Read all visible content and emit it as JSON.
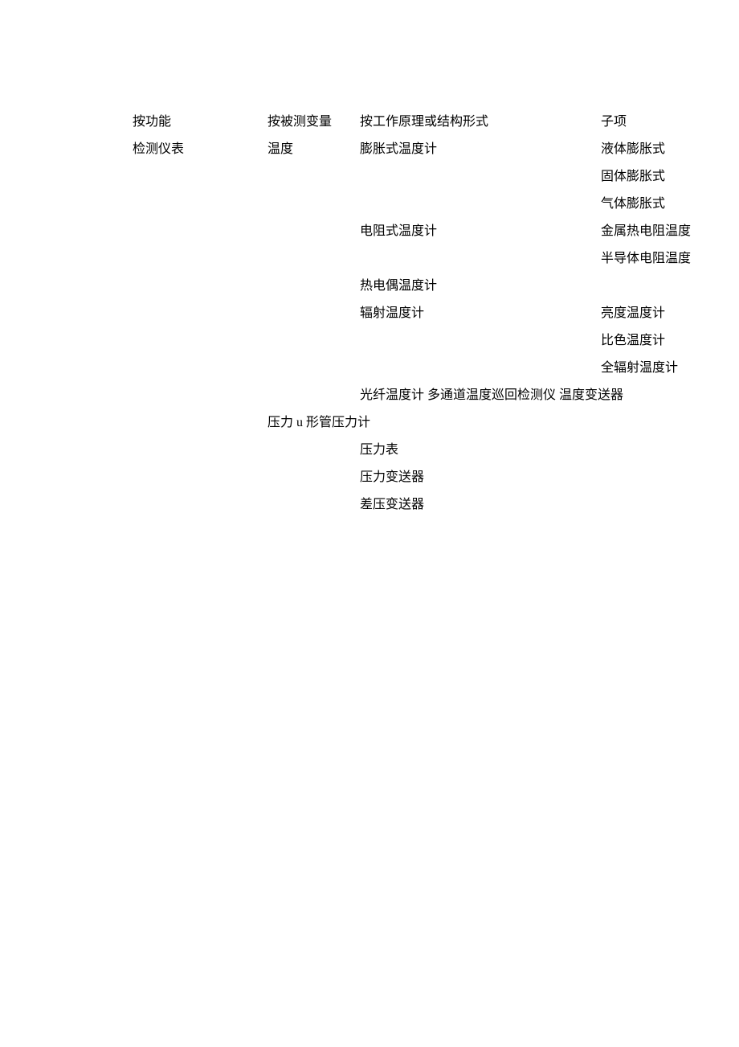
{
  "header": {
    "col1": "按功能",
    "col2": "按被测变量",
    "col3": "按工作原理或结构形式",
    "col4": "子项"
  },
  "rows": [
    {
      "col1": "检测仪表",
      "col2": "温度",
      "col3": "膨胀式温度计",
      "col4": "液体膨胀式"
    },
    {
      "col1": "",
      "col2": "",
      "col3": "",
      "col4": "固体膨胀式"
    },
    {
      "col1": "",
      "col2": "",
      "col3": "",
      "col4": "气体膨胀式"
    },
    {
      "col1": "",
      "col2": "",
      "col3": "电阻式温度计",
      "col4": "金属热电阻温度"
    },
    {
      "col1": "",
      "col2": "",
      "col3": "",
      "col4": "半导体电阻温度"
    },
    {
      "col1": "",
      "col2": "",
      "col3": "热电偶温度计",
      "col4": ""
    },
    {
      "col1": "",
      "col2": "",
      "col3": "辐射温度计",
      "col4": "亮度温度计"
    },
    {
      "col1": "",
      "col2": "",
      "col3": "",
      "col4": "比色温度计"
    },
    {
      "col1": "",
      "col2": "",
      "col3": "",
      "col4": "全辐射温度计"
    },
    {
      "col1": "",
      "col2": "",
      "col3": "光纤温度计  多通道温度巡回检测仪  温度变送器",
      "col4": ""
    }
  ],
  "pressure_line": "压力 u 形管压力计",
  "col3_lines": [
    "压力表",
    "压力变送器",
    "差压变送器"
  ]
}
